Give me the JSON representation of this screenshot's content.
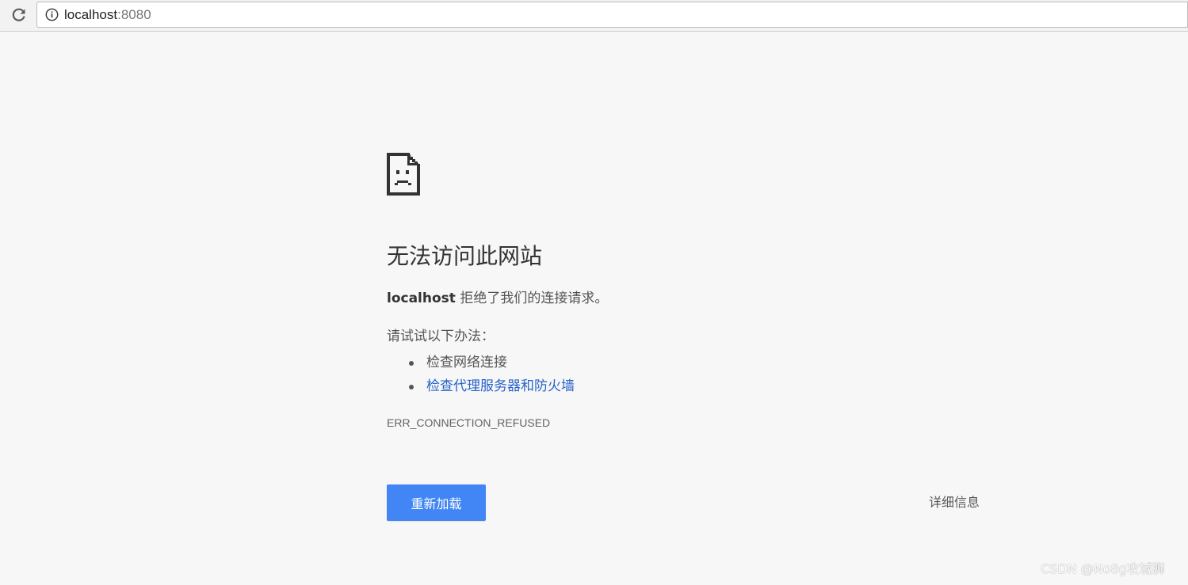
{
  "browser": {
    "reload_icon": "reload-icon",
    "info_icon": "info-icon",
    "url_host": "localhost",
    "url_port": ":8080"
  },
  "error_page": {
    "icon": "sad-page-icon",
    "heading": "无法访问此网站",
    "summary_host": "localhost",
    "summary_text": " 拒绝了我们的连接请求。",
    "suggestions_title": "请试试以下办法：",
    "suggestions": [
      {
        "label": "检查网络连接",
        "is_link": false
      },
      {
        "label": "检查代理服务器和防火墙",
        "is_link": true
      }
    ],
    "error_code": "ERR_CONNECTION_REFUSED",
    "reload_button": "重新加载",
    "details_button": "详细信息"
  },
  "watermark": "CSDN @No8g攻城狮",
  "colors": {
    "accent": "#4285f4",
    "link": "#2962c9",
    "background": "#f7f7f7"
  }
}
